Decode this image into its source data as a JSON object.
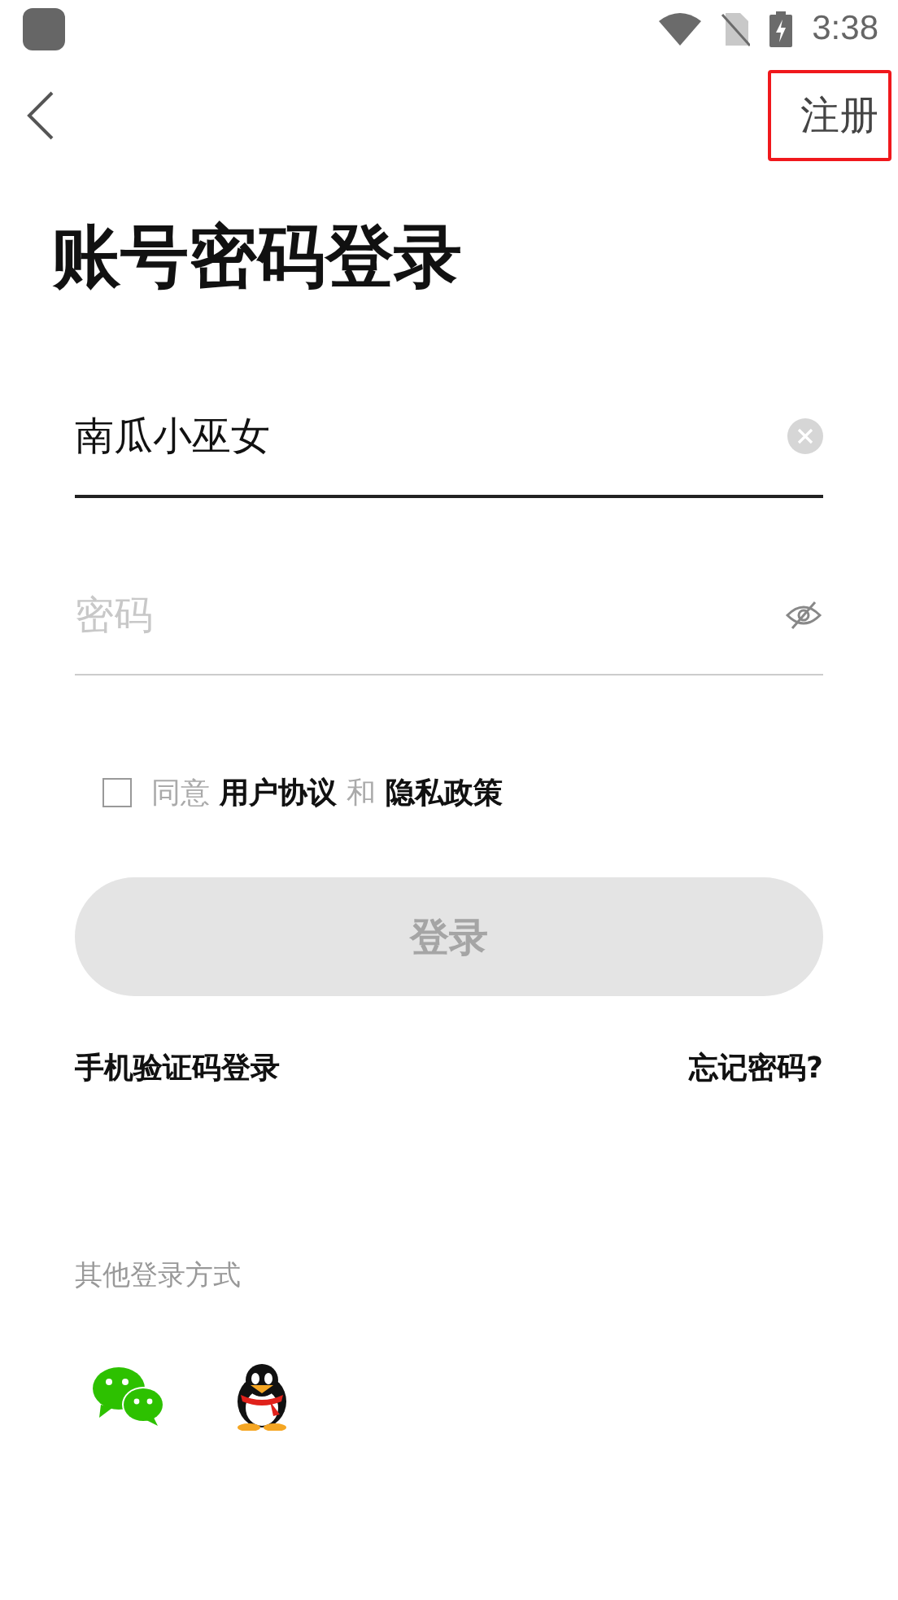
{
  "status_bar": {
    "time": "3:38"
  },
  "nav": {
    "register": {
      "label": "注册",
      "highlighted": true
    }
  },
  "title": "账号密码登录",
  "username": {
    "value": "南瓜小巫女",
    "focused": true
  },
  "password": {
    "placeholder": "密码",
    "focused": false
  },
  "agreement": {
    "checked": false,
    "parts": [
      {
        "kind": "text",
        "text": "同意"
      },
      {
        "kind": "link",
        "text": "用户协议"
      },
      {
        "kind": "text",
        "text": "和"
      },
      {
        "kind": "link",
        "text": "隐私政策"
      }
    ]
  },
  "login_button": {
    "label": "登录",
    "disabled": true
  },
  "links": {
    "sms_login": "手机验证码登录",
    "forgot_password": "忘记密码?"
  },
  "other_login": {
    "label": "其他登录方式"
  }
}
